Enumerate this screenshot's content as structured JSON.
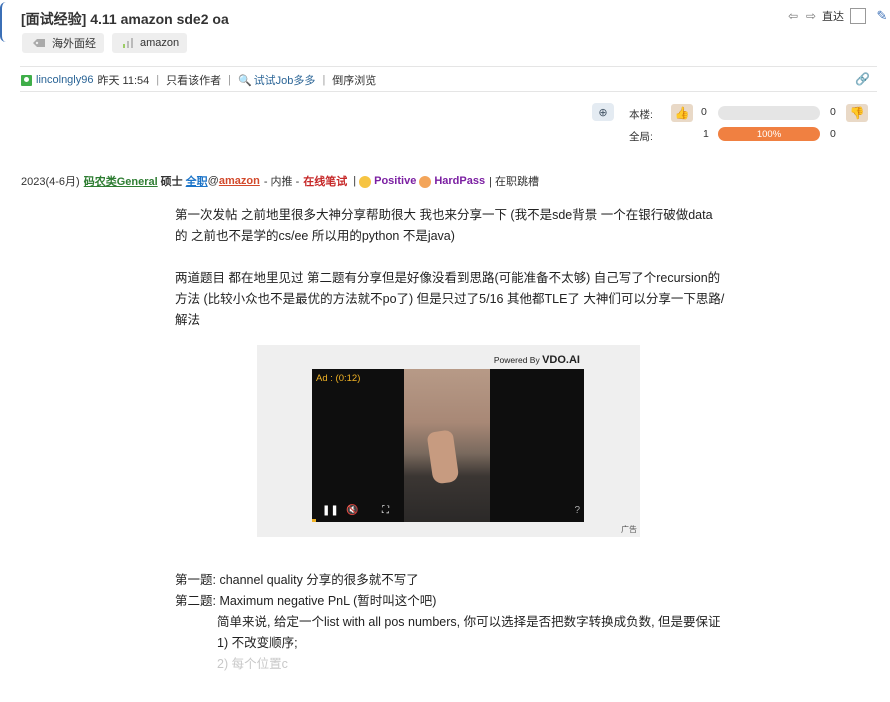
{
  "thread": {
    "title": "[面试经验] 4.11 amazon sde2 oa",
    "tags": [
      {
        "label": "海外面经",
        "icon": "tag-icon"
      },
      {
        "label": "amazon",
        "icon": "bar-chart-icon"
      }
    ]
  },
  "nav": {
    "prev_icon": "arrow-left-icon",
    "next_icon": "arrow-right-icon",
    "goto_label": "直达"
  },
  "meta": {
    "author": "lincolngly96",
    "time": "昨天 11:54",
    "only_author": "只看该作者",
    "job_link": "试试Job多多",
    "reverse": "倒序浏览"
  },
  "vote": {
    "this_floor_label": "本楼:",
    "all_label": "全局:",
    "this_floor_up": "0",
    "this_floor_down": "0",
    "all_up": "1",
    "all_down": "0",
    "all_percent_text": "100%",
    "this_floor_fraction": 0,
    "all_fraction": 1,
    "accent_color": "#f08041"
  },
  "postinfo": {
    "period": "2023(4-6月)",
    "category": "码农类General",
    "degree": "硕士",
    "employment": "全职",
    "at": "@",
    "company": "amazon",
    "referral": "- 内推 -",
    "method": "在线笔试",
    "sep": "|",
    "result_positive": "Positive",
    "result_hardpass": "HardPass",
    "tail": "| 在职跳槽"
  },
  "post": {
    "p1": "第一次发帖 之前地里很多大神分享帮助很大 我也来分享一下 (我不是sde背景 一个在银行破做data的 之前也不是学的cs/ee 所以用的python 不是java)",
    "p2": "两道题目 都在地里见过 第二题有分享但是好像没看到思路(可能准备不太够) 自己写了个recursion的方法 (比较小众也不是最优的方法就不po了) 但是只过了5/16 其他都TLE了 大神们可以分享一下思路/解法",
    "q1": "第一题: channel quality 分享的很多就不写了",
    "q2": "第二题: Maximum negative PnL (暂时叫这个吧)",
    "q2_desc": "简单来说, 给定一个list with all pos numbers, 你可以选择是否把数字转换成负数, 但是要保证",
    "rule1": "1) 不改变顺序;",
    "rule2": "2) 每个位置c"
  },
  "ad": {
    "powered_prefix": "Powered By",
    "powered_brand": "VDO.AI",
    "timer": "Ad : (0:12)",
    "ad_label": "广告"
  }
}
